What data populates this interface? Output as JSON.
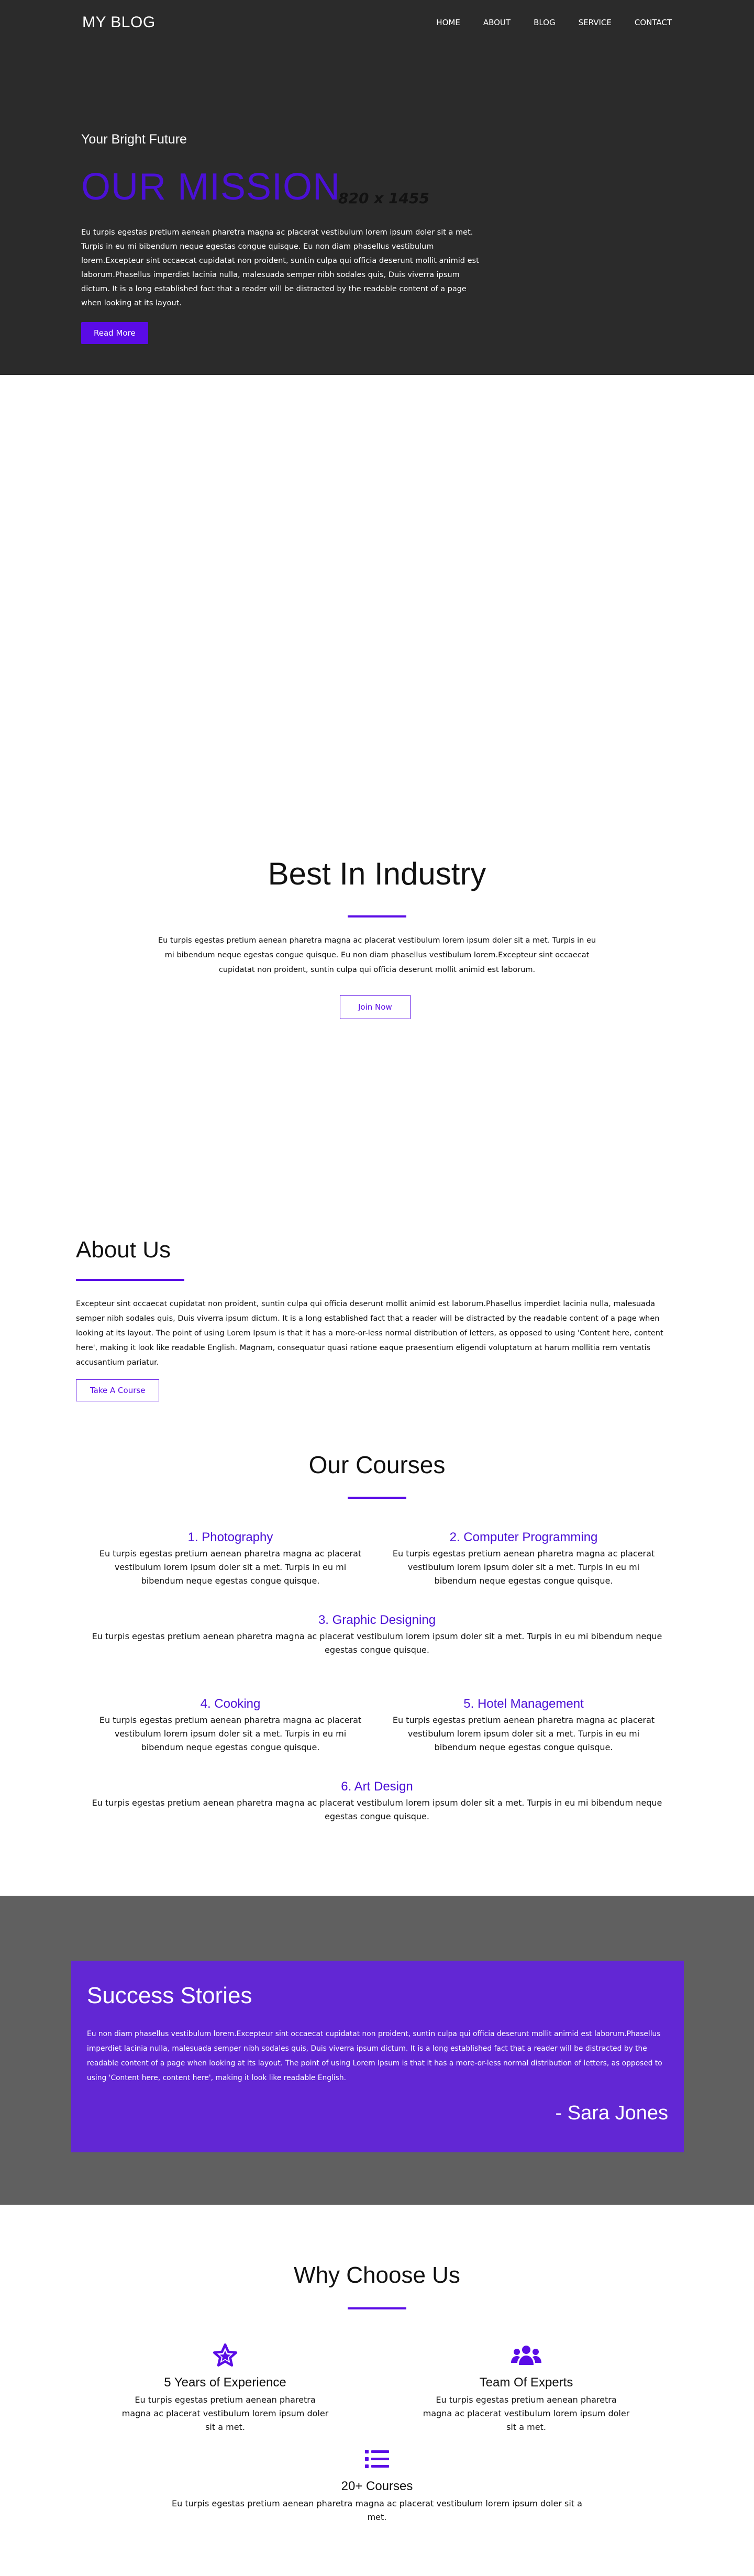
{
  "nav": {
    "brand": "MY BLOG",
    "items": [
      "HOME",
      "ABOUT",
      "BLOG",
      "SERVICE",
      "CONTACT"
    ]
  },
  "hero": {
    "kicker": "Your Bright Future",
    "title": "OUR MISSION",
    "dimensions": "820 x 1455",
    "text": "Eu turpis egestas pretium aenean pharetra magna ac placerat vestibulum lorem ipsum doler sit a met. Turpis in eu mi bibendum neque egestas congue quisque. Eu non diam phasellus vestibulum lorem.Excepteur sint occaecat cupidatat non proident, suntin culpa qui officia deserunt mollit animid est laborum.Phasellus imperdiet lacinia nulla, malesuada semper nibh sodales quis, Duis viverra ipsum dictum. It is a long established fact that a reader will be distracted by the readable content of a page when looking at its layout.",
    "button": "Read More"
  },
  "best": {
    "title": "Best In Industry",
    "text": "Eu turpis egestas pretium aenean pharetra magna ac placerat vestibulum lorem ipsum doler sit a met. Turpis in eu mi bibendum neque egestas congue quisque. Eu non diam phasellus vestibulum lorem.Excepteur sint occaecat cupidatat non proident, suntin culpa qui officia deserunt mollit animid est laborum.",
    "button": "Join Now"
  },
  "about": {
    "title": "About Us",
    "text": "Excepteur sint occaecat cupidatat non proident, suntin culpa qui officia deserunt mollit animid est laborum.Phasellus imperdiet lacinia nulla, malesuada semper nibh sodales quis, Duis viverra ipsum dictum. It is a long established fact that a reader will be distracted by the readable content of a page when looking at its layout. The point of using Lorem Ipsum is that it has a more-or-less normal distribution of letters, as opposed to using 'Content here, content here', making it look like readable English. Magnam, consequatur quasi ratione eaque praesentium eligendi voluptatum at harum mollitia rem ventatis accusantium pariatur.",
    "button": "Take A Course"
  },
  "courses": {
    "title": "Our Courses",
    "items": [
      {
        "title": "1. Photography",
        "desc": "Eu turpis egestas pretium aenean pharetra magna ac placerat vestibulum lorem ipsum doler sit a met. Turpis in eu mi bibendum neque egestas congue quisque."
      },
      {
        "title": "2. Computer Programming",
        "desc": "Eu turpis egestas pretium aenean pharetra magna ac placerat vestibulum lorem ipsum doler sit a met. Turpis in eu mi bibendum neque egestas congue quisque."
      },
      {
        "title": "3. Graphic Designing",
        "desc": "Eu turpis egestas pretium aenean pharetra magna ac placerat vestibulum lorem ipsum doler sit a met. Turpis in eu mi bibendum neque egestas congue quisque."
      },
      {
        "title": "4. Cooking",
        "desc": "Eu turpis egestas pretium aenean pharetra magna ac placerat vestibulum lorem ipsum doler sit a met. Turpis in eu mi bibendum neque egestas congue quisque."
      },
      {
        "title": "5. Hotel Management",
        "desc": "Eu turpis egestas pretium aenean pharetra magna ac placerat vestibulum lorem ipsum doler sit a met. Turpis in eu mi bibendum neque egestas congue quisque."
      },
      {
        "title": "6. Art Design",
        "desc": "Eu turpis egestas pretium aenean pharetra magna ac placerat vestibulum lorem ipsum doler sit a met. Turpis in eu mi bibendum neque egestas congue quisque."
      }
    ]
  },
  "success": {
    "title": "Success Stories",
    "text": "Eu non diam phasellus vestibulum lorem.Excepteur sint occaecat cupidatat non proident, suntin culpa qui officia deserunt mollit animid est laborum.Phasellus imperdiet lacinia nulla, malesuada semper nibh sodales quis, Duis viverra ipsum dictum. It is a long established fact that a reader will be distracted by the readable content of a page when looking at its layout. The point of using Lorem Ipsum is that it has a more-or-less normal distribution of letters, as opposed to using 'Content here, content here', making it look like readable English.",
    "author": "- Sara Jones"
  },
  "why": {
    "title": "Why Choose Us",
    "items": [
      {
        "icon": "star-icon",
        "title": "5 Years of Experience",
        "desc": "Eu turpis egestas pretium aenean pharetra magna ac placerat vestibulum lorem ipsum doler sit a met."
      },
      {
        "icon": "users-icon",
        "title": "Team Of Experts",
        "desc": "Eu turpis egestas pretium aenean pharetra magna ac placerat vestibulum lorem ipsum doler sit a met."
      },
      {
        "icon": "list-icon",
        "title": "20+ Courses",
        "desc": "Eu turpis egestas pretium aenean pharetra magna ac placerat vestibulum lorem ipsum doler sit a met."
      }
    ]
  },
  "colors": {
    "accent": "#5a0be6",
    "hero_bg": "#2b2b2b",
    "success_bg": "#6227d4",
    "success_wrap_bg": "#606060"
  }
}
